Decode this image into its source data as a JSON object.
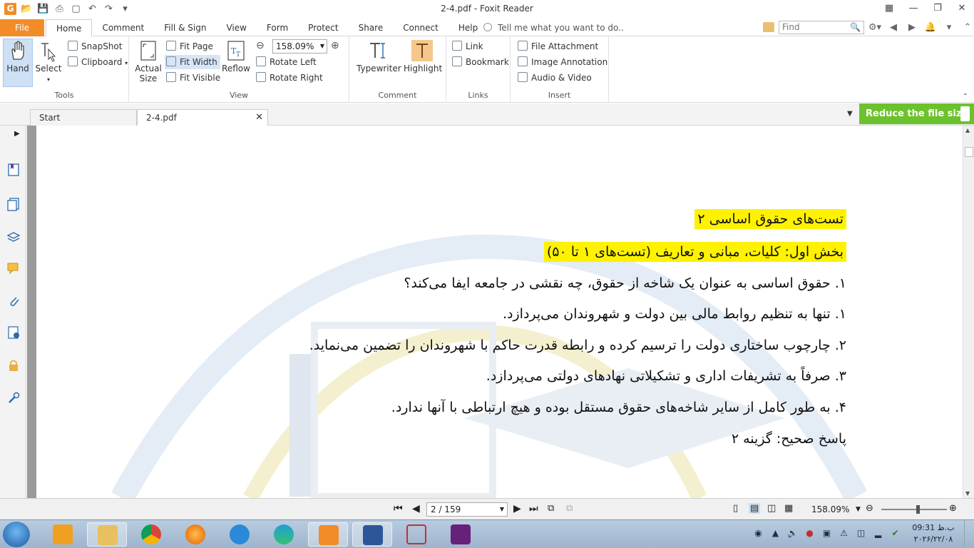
{
  "window": {
    "title": "2-4.pdf - Foxit Reader"
  },
  "menu": {
    "file": "File",
    "tabs": [
      "Home",
      "Comment",
      "Fill & Sign",
      "View",
      "Form",
      "Protect",
      "Share",
      "Connect",
      "Help"
    ],
    "active_tab": "Home",
    "tell_me": "Tell me what you want to do..",
    "find_placeholder": "Find"
  },
  "ribbon": {
    "tools": {
      "label": "Tools",
      "hand": "Hand",
      "select": "Select",
      "snapshot": "SnapShot",
      "clipboard": "Clipboard"
    },
    "view": {
      "label": "View",
      "actual_size_1": "Actual",
      "actual_size_2": "Size",
      "fit_page": "Fit Page",
      "fit_width": "Fit Width",
      "fit_visible": "Fit Visible",
      "reflow": "Reflow",
      "zoom": "158.09%",
      "rotate_left": "Rotate Left",
      "rotate_right": "Rotate Right"
    },
    "comment": {
      "label": "Comment",
      "typewriter": "Typewriter",
      "highlight": "Highlight"
    },
    "links": {
      "label": "Links",
      "link": "Link",
      "bookmark": "Bookmark"
    },
    "insert": {
      "label": "Insert",
      "file_attachment": "File Attachment",
      "image_annotation": "Image Annotation",
      "audio_video": "Audio & Video"
    }
  },
  "doc_tabs": {
    "start": "Start",
    "current": "2-4.pdf",
    "promo": "Reduce the file size"
  },
  "document": {
    "title": "تست‌های حقوق اساسی ۲",
    "section": "بخش اول: کلیات، مبانی و تعاریف (تست‌های ۱ تا ۵۰)",
    "question": "۱. حقوق اساسی به عنوان یک شاخه از حقوق، چه نقشی در جامعه ایفا می‌کند؟",
    "options": [
      "۱.  تنها به تنظیم روابط مالی بین دولت و شهروندان می‌پردازد.",
      "۲.  چارچوب ساختاری دولت را ترسیم کرده و رابطه قدرت حاکم با شهروندان را تضمین می‌نماید.",
      "۳.  صرفاً به تشریفات اداری و تشکیلاتی نهادهای دولتی می‌پردازد.",
      "۴.  به طور کامل از سایر شاخه‌های حقوق مستقل بوده و هیچ ارتباطی با آنها ندارد."
    ],
    "answer": "پاسخ صحیح:  گزینه ۲",
    "highlight_color": "#fff200"
  },
  "status": {
    "page": "2 / 159",
    "zoom": "158.09%",
    "zoom_slider_fraction": 0.55
  },
  "taskbar": {
    "clock_time": "09:31 ب.ظ",
    "clock_date": "۲۰۲۶/۲۲/۰۸"
  },
  "colors": {
    "accent": "#f28c28",
    "promo": "#6cc22c"
  }
}
